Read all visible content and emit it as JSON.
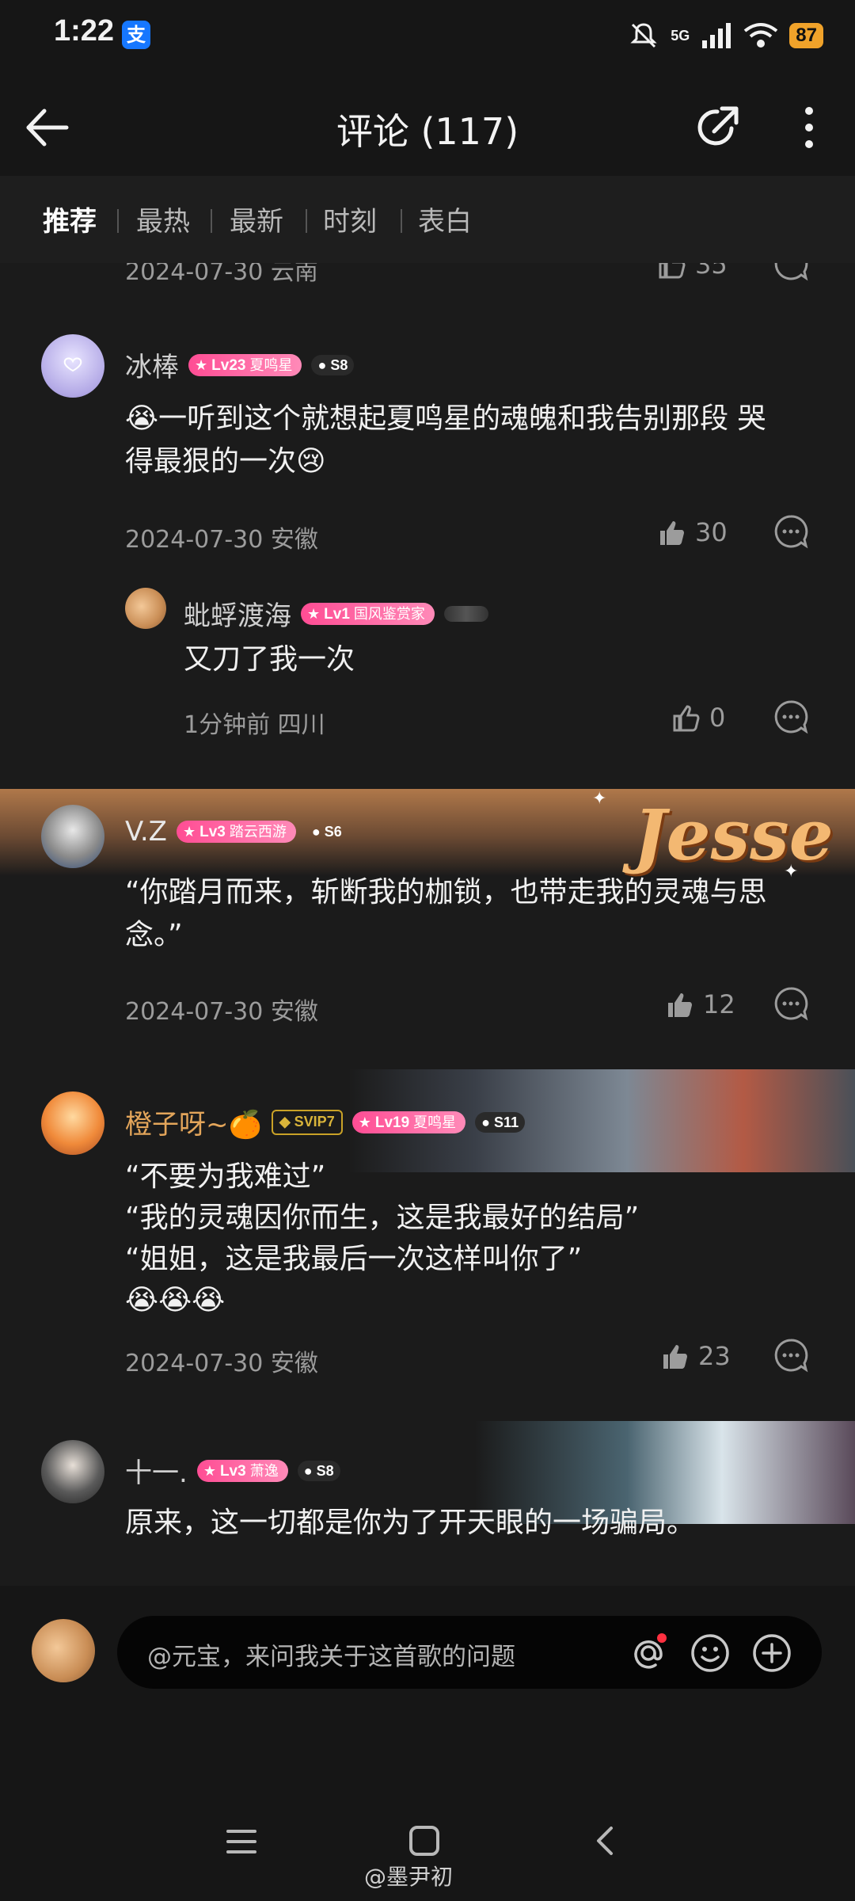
{
  "status_bar": {
    "time": "1:22",
    "alipay_label": "支",
    "network": "5G",
    "battery": "87"
  },
  "header": {
    "title": "评论 (117)"
  },
  "tabs": [
    "推荐",
    "最热",
    "最新",
    "时刻",
    "表白"
  ],
  "comments": {
    "partial_top": {
      "meta": "2024-07-30 云南",
      "likes": "35"
    },
    "c1": {
      "user": "冰棒",
      "level": "Lv23",
      "level_title": "夏鸣星",
      "s_badge": "S8",
      "text_line1": "😭一听到这个就想起夏鸣星的魂魄和我告别那段 哭",
      "text_line2": "得最狠的一次😢",
      "meta": "2024-07-30 安徽",
      "likes": "30",
      "reply": {
        "user": "蚍蜉渡海",
        "level": "Lv1",
        "level_title": "国风鉴赏家",
        "text": "又刀了我一次",
        "meta": "1分钟前 四川",
        "likes": "0"
      }
    },
    "c2": {
      "user": "V.Z",
      "level": "Lv3",
      "level_title": "踏云西游",
      "s_badge": "S6",
      "decor_text": "Jesse",
      "text_line1": "“你踏月而来，斩断我的枷锁，也带走我的灵魂与思",
      "text_line2": "念。”",
      "meta": "2024-07-30 安徽",
      "likes": "12"
    },
    "c3": {
      "user": "橙子呀~🍊",
      "vip": "SVIP7",
      "level": "Lv19",
      "level_title": "夏鸣星",
      "s_badge": "S11",
      "text_line1": "“不要为我难过”",
      "text_line2": "“我的灵魂因你而生，这是我最好的结局”",
      "text_line3": "“姐姐，这是我最后一次这样叫你了”",
      "text_line4": "😭😭😭",
      "meta": "2024-07-30 安徽",
      "likes": "23"
    },
    "c4": {
      "user": "十一.",
      "level": "Lv3",
      "level_title": "萧逸",
      "s_badge": "S8",
      "text_line1": "原来，这一切都是你为了开天眼的一场骗局。"
    }
  },
  "input": {
    "placeholder": "@元宝，来问我关于这首歌的问题"
  },
  "watermark": "@墨尹初",
  "colors": {
    "background": "#1b1b1b",
    "badge_pink": "#ff4d94",
    "battery": "#f0a22a",
    "vip_gold": "#c9a227"
  }
}
